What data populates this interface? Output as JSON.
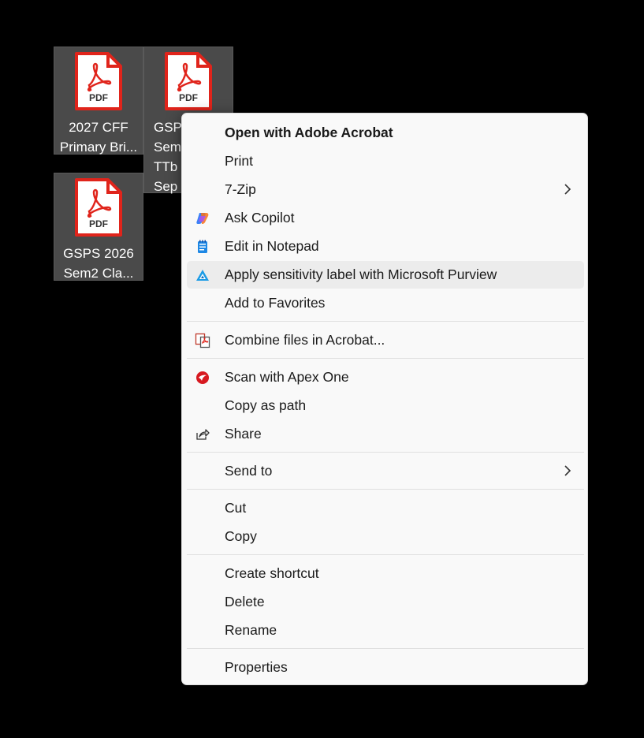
{
  "desktop": {
    "icons": [
      {
        "line1": "2027 CFF",
        "line2": "Primary Bri..."
      },
      {
        "line1": "GSPS",
        "line2": "Sem",
        "line3": "TTb (",
        "line4": "Sep"
      },
      {
        "line1": "GSPS 2026",
        "line2": "Sem2 Cla..."
      }
    ],
    "pdf_badge": "PDF"
  },
  "menu": {
    "open_with_acrobat": "Open with Adobe Acrobat",
    "print": "Print",
    "seven_zip": "7-Zip",
    "ask_copilot": "Ask Copilot",
    "edit_notepad": "Edit in Notepad",
    "apply_label": "Apply sensitivity label with Microsoft Purview",
    "add_favorites": "Add to Favorites",
    "combine_files": "Combine files in Acrobat...",
    "scan_apex": "Scan with Apex One",
    "copy_path": "Copy as path",
    "share": "Share",
    "send_to": "Send to",
    "cut": "Cut",
    "copy": "Copy",
    "create_shortcut": "Create shortcut",
    "delete": "Delete",
    "rename": "Rename",
    "properties": "Properties"
  },
  "colors": {
    "pdf_red": "#e0241b",
    "copilot": "#7b61ff",
    "notepad": "#1e88e5",
    "purview": "#1a9be6",
    "apex": "#d71920"
  }
}
